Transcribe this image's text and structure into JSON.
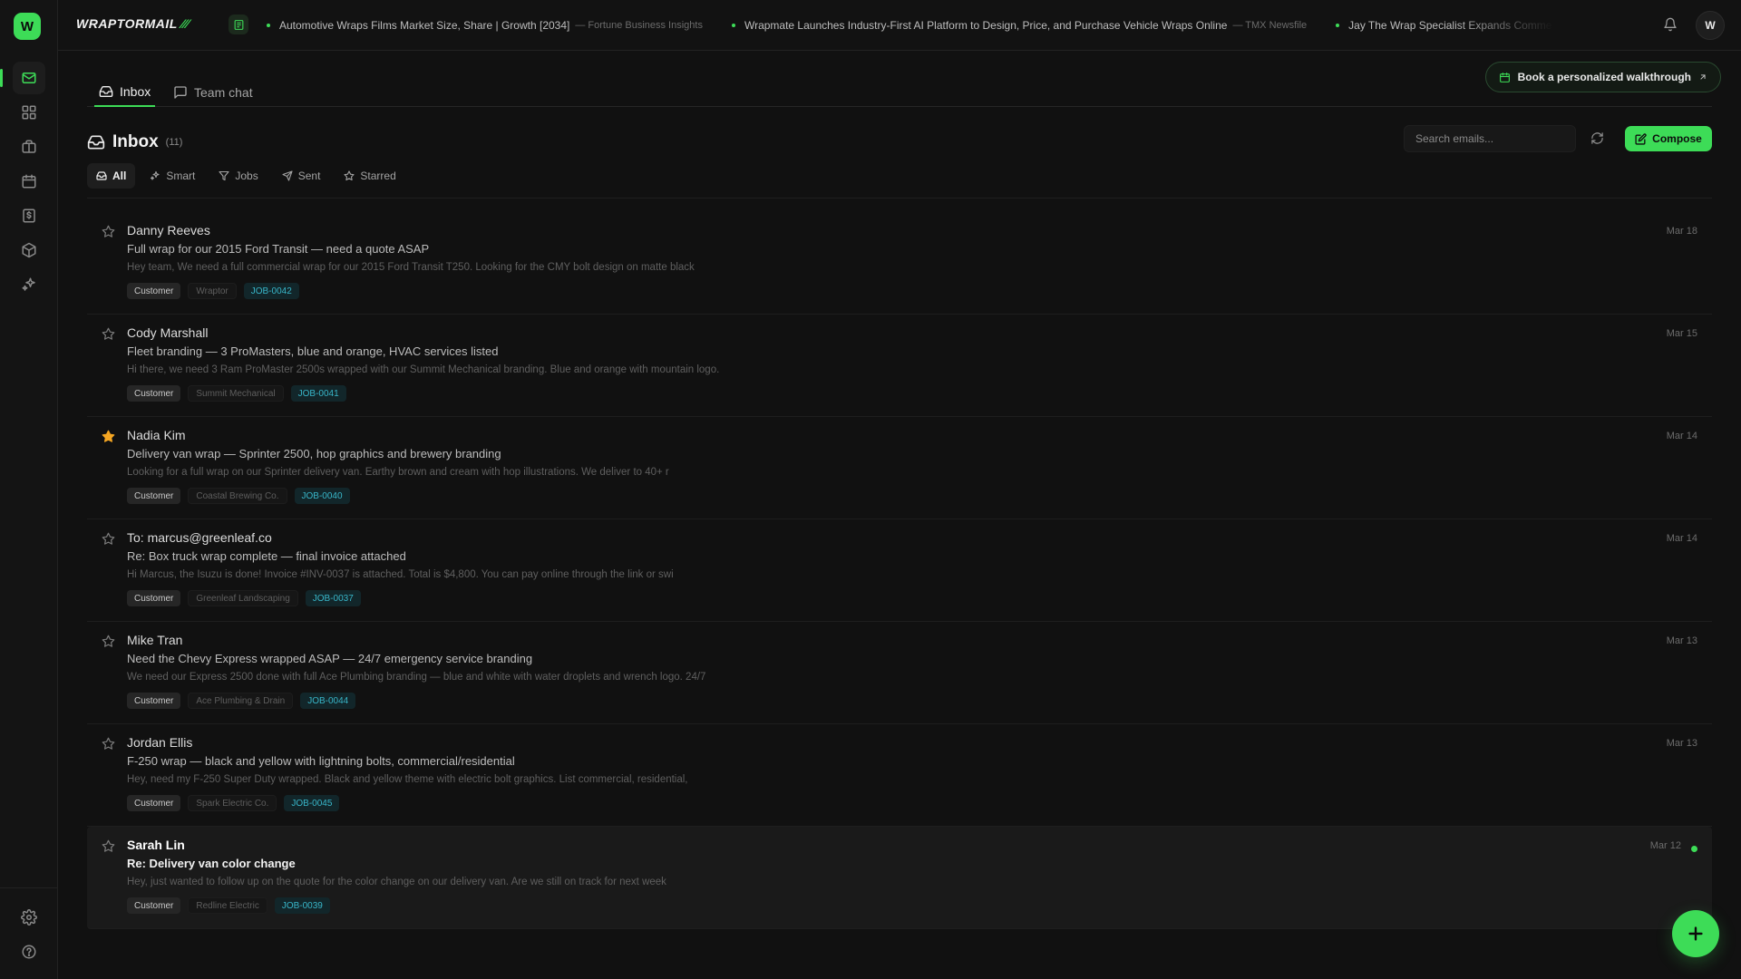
{
  "app": {
    "logo_letter": "W",
    "brand_name": "WRAPTORMAIL",
    "brand_mark": "⁄⁄⁄",
    "avatar_letter": "W",
    "accent_color": "#3ddc57"
  },
  "rail": {
    "items": [
      {
        "name": "mail",
        "icon": "mail-icon",
        "active": true
      },
      {
        "name": "dashboard",
        "icon": "grid-icon",
        "active": false
      },
      {
        "name": "jobs",
        "icon": "briefcase-icon",
        "active": false
      },
      {
        "name": "calendar",
        "icon": "calendar-icon",
        "active": false
      },
      {
        "name": "invoices",
        "icon": "invoice-icon",
        "active": false
      },
      {
        "name": "inventory",
        "icon": "box-icon",
        "active": false
      },
      {
        "name": "ai",
        "icon": "sparkles-icon",
        "active": false
      }
    ],
    "bottom": [
      {
        "name": "settings",
        "icon": "gear-icon"
      },
      {
        "name": "help",
        "icon": "help-icon"
      }
    ]
  },
  "news": [
    {
      "title": "Automotive Wraps Films Market Size, Share | Growth [2034]",
      "source": "— Fortune Business Insights"
    },
    {
      "title": "Wrapmate Launches Industry-First AI Platform to Design, Price, and Purchase Vehicle Wraps Online",
      "source": "— TMX Newsfile"
    },
    {
      "title": "Jay The Wrap Specialist Expands Commercial Vehicle Wrap Services",
      "source": ""
    }
  ],
  "tabs": [
    {
      "label": "Inbox",
      "icon": "inbox-icon",
      "active": true
    },
    {
      "label": "Team chat",
      "icon": "chat-icon",
      "active": false
    }
  ],
  "walkthrough_label": "Book a personalized walkthrough",
  "inbox": {
    "title": "Inbox",
    "count": "(11)",
    "search_placeholder": "Search emails...",
    "compose_label": "Compose"
  },
  "filters": [
    {
      "label": "All",
      "icon": "inbox-icon",
      "active": true
    },
    {
      "label": "Smart",
      "icon": "sparkles-icon",
      "active": false
    },
    {
      "label": "Jobs",
      "icon": "funnel-icon",
      "active": false
    },
    {
      "label": "Sent",
      "icon": "send-icon",
      "active": false
    },
    {
      "label": "Starred",
      "icon": "star-icon",
      "active": false
    }
  ],
  "emails": [
    {
      "sender": "Danny Reeves",
      "subject": "Full wrap for our 2015 Ford Transit — need a quote ASAP",
      "preview": "Hey team, We need a full commercial wrap for our 2015 Ford Transit T250. Looking for the CMY bolt design on matte black",
      "tags": {
        "type": "Customer",
        "company": "Wraptor",
        "job": "JOB-0042"
      },
      "date": "Mar 18",
      "starred": false,
      "unread": false
    },
    {
      "sender": "Cody Marshall",
      "subject": "Fleet branding — 3 ProMasters, blue and orange, HVAC services listed",
      "preview": "Hi there, we need 3 Ram ProMaster 2500s wrapped with our Summit Mechanical branding. Blue and orange with mountain logo.",
      "tags": {
        "type": "Customer",
        "company": "Summit Mechanical",
        "job": "JOB-0041"
      },
      "date": "Mar 15",
      "starred": false,
      "unread": false
    },
    {
      "sender": "Nadia Kim",
      "subject": "Delivery van wrap — Sprinter 2500, hop graphics and brewery branding",
      "preview": "Looking for a full wrap on our Sprinter delivery van. Earthy brown and cream with hop illustrations. We deliver to 40+ r",
      "tags": {
        "type": "Customer",
        "company": "Coastal Brewing Co.",
        "job": "JOB-0040"
      },
      "date": "Mar 14",
      "starred": true,
      "unread": false
    },
    {
      "sender": "To: marcus@greenleaf.co",
      "subject": "Re: Box truck wrap complete — final invoice attached",
      "preview": "Hi Marcus, the Isuzu is done! Invoice #INV-0037 is attached. Total is $4,800. You can pay online through the link or swi",
      "tags": {
        "type": "Customer",
        "company": "Greenleaf Landscaping",
        "job": "JOB-0037"
      },
      "date": "Mar 14",
      "starred": false,
      "unread": false
    },
    {
      "sender": "Mike Tran",
      "subject": "Need the Chevy Express wrapped ASAP — 24/7 emergency service branding",
      "preview": "We need our Express 2500 done with full Ace Plumbing branding — blue and white with water droplets and wrench logo. 24/7",
      "tags": {
        "type": "Customer",
        "company": "Ace Plumbing & Drain",
        "job": "JOB-0044"
      },
      "date": "Mar 13",
      "starred": false,
      "unread": false
    },
    {
      "sender": "Jordan Ellis",
      "subject": "F-250 wrap — black and yellow with lightning bolts, commercial/residential",
      "preview": "Hey, need my F-250 Super Duty wrapped. Black and yellow theme with electric bolt graphics. List commercial, residential,",
      "tags": {
        "type": "Customer",
        "company": "Spark Electric Co.",
        "job": "JOB-0045"
      },
      "date": "Mar 13",
      "starred": false,
      "unread": false
    },
    {
      "sender": "Sarah Lin",
      "subject": "Re: Delivery van color change",
      "preview": "Hey, just wanted to follow up on the quote for the color change on our delivery van. Are we still on track for next week",
      "tags": {
        "type": "Customer",
        "company": "Redline Electric",
        "job": "JOB-0039"
      },
      "date": "Mar 12",
      "starred": false,
      "unread": true
    }
  ]
}
